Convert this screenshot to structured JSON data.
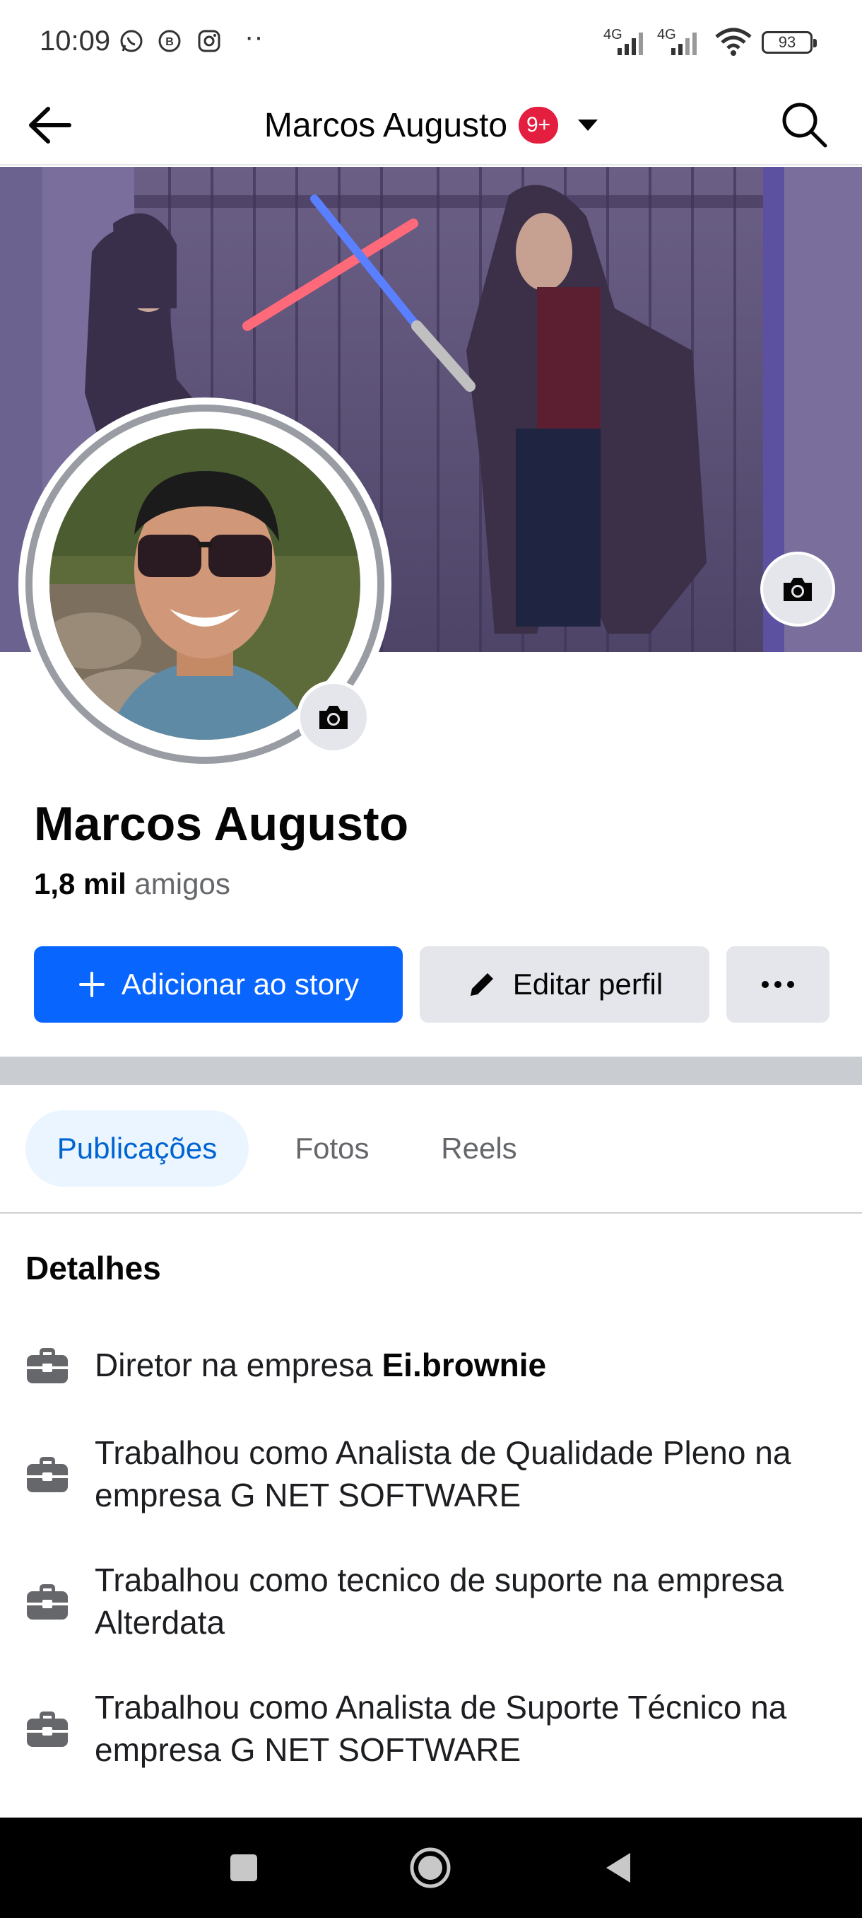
{
  "status_bar": {
    "time": "10:09",
    "apps": [
      "whatsapp-icon",
      "whatsapp-business-icon",
      "instagram-icon"
    ],
    "overflow": "··",
    "net1": "4G",
    "net2": "4G",
    "battery": "93"
  },
  "header": {
    "title": "Marcos Augusto",
    "badge": "9+"
  },
  "profile": {
    "name": "Marcos Augusto",
    "friends_count": "1,8 mil",
    "friends_label": "amigos"
  },
  "actions": {
    "add_story": "Adicionar ao story",
    "edit_profile": "Editar perfil",
    "more": "···"
  },
  "tabs": [
    {
      "label": "Publicações",
      "active": true
    },
    {
      "label": "Fotos",
      "active": false
    },
    {
      "label": "Reels",
      "active": false
    }
  ],
  "details": {
    "title": "Detalhes",
    "items": [
      {
        "prefix": "Diretor na empresa ",
        "bold": "Ei.brownie",
        "text": ""
      },
      {
        "prefix": "",
        "bold": "",
        "text": "Trabalhou como Analista de Qualidade Pleno na empresa G NET SOFTWARE"
      },
      {
        "prefix": "",
        "bold": "",
        "text": "Trabalhou como tecnico de suporte na empresa Alterdata"
      },
      {
        "prefix": "",
        "bold": "",
        "text": "Trabalhou como Analista de Suporte Técnico na empresa G NET SOFTWARE"
      }
    ]
  },
  "colors": {
    "primary": "#0866ff",
    "badge": "#e41e3f",
    "tab_active_bg": "#ebf5ff",
    "tab_active_text": "#0064d1",
    "secondary_btn": "#e4e6eb"
  }
}
